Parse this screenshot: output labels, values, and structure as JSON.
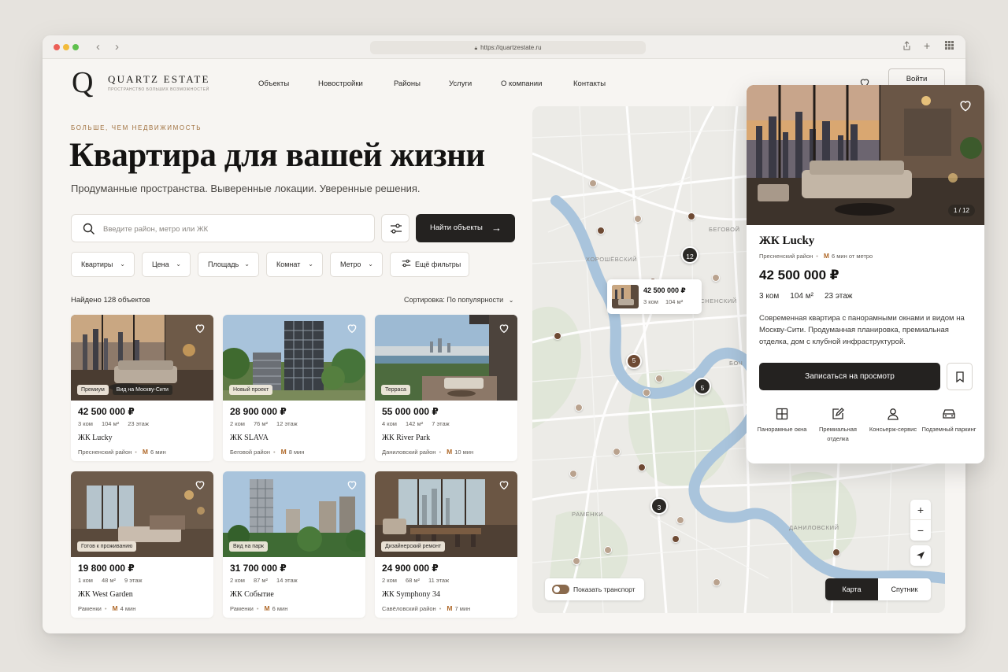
{
  "browser": {
    "url": "https://quartzestate.ru",
    "dots": [
      "#ec5f57",
      "#f2bb3a",
      "#5fc04d"
    ]
  },
  "header": {
    "logo_letter": "Q",
    "logo_name": "QUARTZ ESTATE",
    "logo_tagline": "ПРОСТРАНСТВО БОЛЬШИХ ВОЗМОЖНОСТЕЙ",
    "nav": [
      {
        "label": "Объекты"
      },
      {
        "label": "Новостройки"
      },
      {
        "label": "Районы"
      },
      {
        "label": "Услуги"
      },
      {
        "label": "О компании"
      },
      {
        "label": "Контакты"
      }
    ],
    "login_label": "Войти"
  },
  "hero": {
    "eyebrow": "БОЛЬШЕ, ЧЕМ НЕДВИЖИМОСТЬ",
    "title": "Квартира для вашей жизни",
    "subtitle": "Продуманные пространства. Выверенные локации. Уверенные решения."
  },
  "search": {
    "placeholder": "Введите район, метро или ЖК",
    "submit_label": "Найти объекты"
  },
  "filters": [
    {
      "label": "Квартиры"
    },
    {
      "label": "Цена"
    },
    {
      "label": "Площадь"
    },
    {
      "label": "Комнат"
    },
    {
      "label": "Метро"
    }
  ],
  "more_filters_label": "Ещё фильтры",
  "results": {
    "found_label": "Найдено 128 объектов",
    "sort_label": "Сортировка: По популярности"
  },
  "listings": [
    {
      "price": "42 500 000 ₽",
      "rooms": "3 ком",
      "area": "104 м²",
      "floor": "23 этаж",
      "name": "ЖК Lucky",
      "district": "Пресненский район",
      "metro": "6 мин",
      "badges": [
        "Премиум",
        "Вид на Москву-Сити"
      ]
    },
    {
      "price": "28 900 000 ₽",
      "rooms": "2 ком",
      "area": "76 м²",
      "floor": "12 этаж",
      "name": "ЖК SLAVA",
      "district": "Беговой район",
      "metro": "8 мин",
      "badges": [
        "Новый проект"
      ]
    },
    {
      "price": "55 000 000 ₽",
      "rooms": "4 ком",
      "area": "142 м²",
      "floor": "7 этаж",
      "name": "ЖК River Park",
      "district": "Даниловский район",
      "metro": "10 мин",
      "badges": [
        "Терраса"
      ]
    },
    {
      "price": "19 800 000 ₽",
      "rooms": "1 ком",
      "area": "48 м²",
      "floor": "9 этаж",
      "name": "ЖК West Garden",
      "district": "Раменки",
      "metro": "4 мин",
      "badges": [
        "Готов к проживанию"
      ]
    },
    {
      "price": "31 700 000 ₽",
      "rooms": "2 ком",
      "area": "87 м²",
      "floor": "14 этаж",
      "name": "ЖК Событие",
      "district": "Раменки",
      "metro": "6 мин",
      "badges": [
        "Вид на парк"
      ]
    },
    {
      "price": "24 900 000 ₽",
      "rooms": "2 ком",
      "area": "68 м²",
      "floor": "11 этаж",
      "name": "ЖК Symphony 34",
      "district": "Савёловский район",
      "metro": "7 мин",
      "badges": [
        "Дизайнерский ремонт"
      ]
    }
  ],
  "map": {
    "districts": [
      "БЕГОВОЙ",
      "ХОРОШЁВСКИЙ",
      "ПРЕСНЕНСКИЙ",
      "РАМЕНКИ",
      "ДАНИЛОВСКИЙ",
      "БОЧ"
    ],
    "clusters": [
      "12",
      "5",
      "5",
      "3"
    ],
    "popup": {
      "price": "42 500 000 ₽",
      "rooms": "3 ком",
      "area": "104 м²"
    },
    "transit_label": "Показать транспорт",
    "map_types": [
      "Карта",
      "Спутник"
    ],
    "active_map_type": "Карта",
    "zoom_in": "+",
    "zoom_out": "−"
  },
  "detail": {
    "title": "ЖК Lucky",
    "district": "Пресненский район",
    "metro": "6 мин от метро",
    "price": "42 500 000 ₽",
    "rooms": "3 ком",
    "area": "104 м²",
    "floor": "23 этаж",
    "description": "Современная квартира с панорамными окнами и видом на Москву-Сити. Продуманная планировка, премиальная отделка, дом с клубной инфраструктурой.",
    "photo_counter": "1 / 12",
    "cta_label": "Записаться на просмотр",
    "amenities": [
      {
        "label": "Панорамные окна",
        "icon": "window-icon"
      },
      {
        "label": "Премиальная отделка",
        "icon": "pencil-edit-icon"
      },
      {
        "label": "Консьерж-сервис",
        "icon": "person-icon"
      },
      {
        "label": "Подземный паркинг",
        "icon": "car-icon"
      }
    ]
  },
  "colors": {
    "accent_dark": "#242220",
    "eyebrow": "#a0713f",
    "metro": "#b06a2b",
    "marker_brown": "#6e4a33",
    "marker_tan": "#b9a28e"
  }
}
